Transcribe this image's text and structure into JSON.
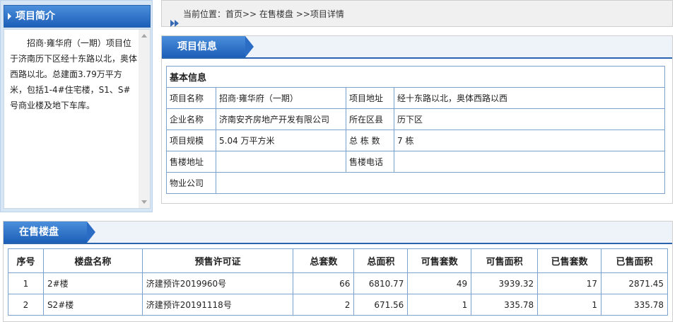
{
  "sidebar": {
    "title": "项目简介",
    "intro": "招商·雍华府（一期）项目位于济南历下区经十东路以北，奥体西路以北。总建面3.79万平方米，包括1-4#住宅楼，S1、S#号商业楼及地下车库。"
  },
  "breadcrumb": {
    "text": "当前位置：首页>> 在售楼盘 >>项目详情"
  },
  "project_info": {
    "section_title": "项目信息",
    "table_title": "基本信息",
    "rows": [
      {
        "label1": "项目名称",
        "value1": "招商·雍华府（一期）",
        "label2": "项目地址",
        "value2": "经十东路以北，奥体西路以西"
      },
      {
        "label1": "企业名称",
        "value1": "济南安齐房地产开发有限公司",
        "label2": "所在区县",
        "value2": "历下区"
      },
      {
        "label1": "项目规模",
        "value1": "5.04 万平方米",
        "label2": "总 栋 数",
        "value2": "7 栋"
      },
      {
        "label1": "售楼地址",
        "value1": "",
        "label2": "售楼电话",
        "value2": ""
      },
      {
        "label1": "物业公司",
        "value1": ""
      }
    ]
  },
  "for_sale": {
    "section_title": "在售楼盘",
    "headers": [
      "序号",
      "楼盘名称",
      "预售许可证",
      "总套数",
      "总面积",
      "可售套数",
      "可售面积",
      "已售套数",
      "已售面积"
    ],
    "rows": [
      [
        "1",
        "2#楼",
        "济建预许2019960号",
        "66",
        "6810.77",
        "49",
        "3939.32",
        "17",
        "2871.45"
      ],
      [
        "2",
        "S2#楼",
        "济建预许20191118号",
        "2",
        "671.56",
        "1",
        "335.78",
        "1",
        "335.78"
      ]
    ]
  },
  "colors": {
    "accent": "#1c5fb8",
    "border": "#7da2ce"
  }
}
